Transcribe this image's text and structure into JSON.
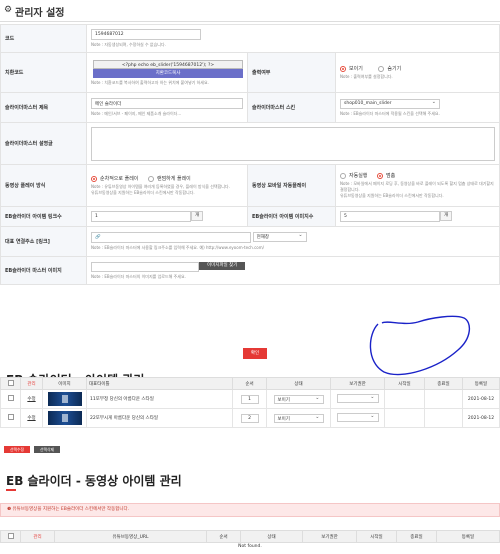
{
  "header": {
    "icon": "gear-icon",
    "title": "관리자 설정"
  },
  "form": {
    "code": {
      "label": "코드",
      "value": "1594687012",
      "note": "Note : 자동생성되며, 수정하실 수 없습니다."
    },
    "skin_code": {
      "label": "치환코드",
      "code_text": "<?php echo eb_slider('1594687012'); ?>",
      "copy_button": "치환코드복사",
      "note": "Note : 치환코드를 복사하여 출력하고자 하는 위치에 붙여넣기 하세요."
    },
    "output": {
      "label": "출력여부",
      "options": [
        "보이기",
        "숨기기"
      ],
      "selected": "보이기",
      "note": "Note : 출력여부를 설정합니다."
    },
    "title": {
      "label": "슬라이더마스터 제목",
      "value": "메인 슬라이더",
      "note": "Note : 메인/서브 - 페이지, 메인 제품소개 슬라이더..."
    },
    "skin": {
      "label": "슬라이더마스터 스킨",
      "value": "shop010_main_slider",
      "note": "Note : EB슬라이더 마스터에 적용될 스킨을 선택해 주세요."
    },
    "description": {
      "label": "슬라이더마스터 설명글",
      "value": ""
    },
    "video_play": {
      "label": "동영상 플레이 방식",
      "options": [
        "순차적으로 플레이",
        "랜덤하게 플레이"
      ],
      "selected": "순차적으로 플레이",
      "note": "Note : 유튜브동영상 아이템을 여러개 등록하였을 경우, 플레이 방식을 선택합니다.",
      "note2": "유튜브동영상을 지원하는 EB슬라이더 스킨에서만 작동합니다."
    },
    "mobile_play": {
      "label": "동영상 모바일 자동플레이",
      "options": [
        "자동실행",
        "멈춤"
      ],
      "selected": "멈춤",
      "note": "Note : 모바일에서 페이지 로딩 후, 동영상을 바로 플레이 되도록 할지 멈춤 상태로 대기할지 결정합니다.",
      "note2": "유튜브동영상을 지원하는 EB슬라이더 스킨에서만 작동합니다."
    },
    "item_link": {
      "label": "EB슬라이더 아이템 링크수",
      "value": "1",
      "unit": "개"
    },
    "item_image": {
      "label": "EB슬라이더 아이템 이미지수",
      "value": "5",
      "unit": "개"
    },
    "rep_link": {
      "label": "대표 연결주소 [링크]",
      "value": "",
      "target": "현재창",
      "note": "Note : EB슬라이더 마스터에 사용할 링크주소를 입력해 주세요. 예) http://www.eyoom-tech.com/"
    },
    "master_image": {
      "label": "EB슬라이더 마스터 이미지",
      "file_button": "이미지파일 찾기",
      "note": "Note : EB슬라이더 마스터의 이미지를 업로드해 주세요."
    }
  },
  "confirm_button": "확인",
  "items_section": {
    "title": "EB 슬라이더 - 아이템 관리",
    "columns": [
      "관리",
      "이미지",
      "대표타이틀",
      "순서",
      "상태",
      "보기권한",
      "시작일",
      "종료일",
      "등록일"
    ],
    "rows": [
      {
        "manage": "수정",
        "title": "11또부정 당신의 아름다운 스타일",
        "order": "1",
        "status": "보이기",
        "view": "",
        "start": "",
        "end": "",
        "date": "2021-08-12"
      },
      {
        "manage": "수정",
        "title": "22또부시게 아름다운 당신의 스타일",
        "order": "2",
        "status": "보이기",
        "view": "",
        "start": "",
        "end": "",
        "date": "2021-08-12"
      }
    ],
    "btn_edit_selected": "선택수정",
    "btn_delete_selected": "선택삭제"
  },
  "video_section": {
    "title": "EB 슬라이더 - 동영상 아이템 관리",
    "notice": "유튜브동영상을 지원하는 EB슬라이더 스킨에서만 작동합니다.",
    "columns": [
      "관리",
      "유튜브동영상_URL",
      "순서",
      "상태",
      "보기권한",
      "시작일",
      "종료일",
      "등록일"
    ],
    "empty": "Not found."
  },
  "colors": {
    "accent": "#e53935",
    "copy_button": "#6b6fc9",
    "annotation": "#1a22c8"
  }
}
